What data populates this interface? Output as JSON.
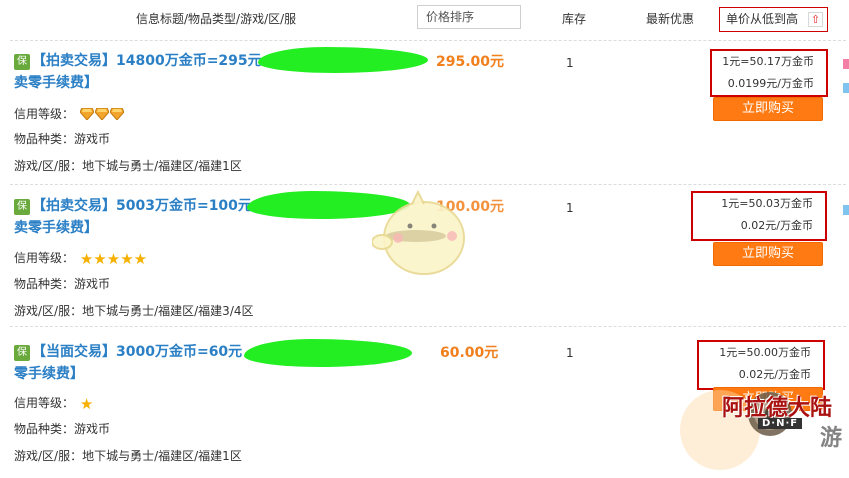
{
  "header": {
    "title_col": "信息标题/物品类型/游戏/区/服",
    "sort_price": "价格排序",
    "stock": "库存",
    "promo": "最新优惠",
    "unit_sort": "单价从低到高",
    "unit_sort_arrow": "up-arrow-icon"
  },
  "listings": [
    {
      "badge": "保",
      "title_line1": "【拍卖交易】14800万金币=295元",
      "title_line2": "卖零手续费】",
      "price": "295.00元",
      "stock": "1",
      "credit_label": "信用等级：",
      "credit_icons": "gem x3",
      "item_type_label": "物品种类：",
      "item_type": "游戏币",
      "server_label": "游戏/区/服：",
      "server": "地下城与勇士/福建区/福建1区",
      "unit_price_1": "1元=50.17万金币",
      "unit_price_2": "0.0199元/万金币",
      "buy_label": "立即购买"
    },
    {
      "badge": "保",
      "title_line1": "【拍卖交易】5003万金币=100元",
      "title_line2": "卖零手续费】",
      "price": "100.00元",
      "stock": "1",
      "credit_label": "信用等级：",
      "credit_icons": "star x5",
      "item_type_label": "物品种类：",
      "item_type": "游戏币",
      "server_label": "游戏/区/服：",
      "server": "地下城与勇士/福建区/福建3/4区",
      "unit_price_1": "1元=50.03万金币",
      "unit_price_2": "0.02元/万金币",
      "buy_label": "立即购买"
    },
    {
      "badge": "保",
      "title_line1": "【当面交易】3000万金币=60元",
      "title_line2": "零手续费】",
      "price": "60.00元",
      "stock": "1",
      "credit_label": "信用等级：",
      "credit_icons": "star x1",
      "item_type_label": "物品种类：",
      "item_type": "游戏币",
      "server_label": "游戏/区/服：",
      "server": "地下城与勇士/福建区/福建1区",
      "unit_price_1": "1元=50.00万金币",
      "unit_price_2": "0.02元/万金币",
      "buy_label": "立即购买"
    }
  ],
  "watermark": {
    "logo_text": "阿拉德大陆",
    "logo_sub": "D·N·F",
    "site_suffix": "游"
  },
  "colors": {
    "title_blue": "#2a7fc5",
    "price_orange": "#f07f1c",
    "buy_orange": "#ff7a12",
    "highlight_red": "#cc0000",
    "badge_green": "#6aaa3c",
    "redaction_green": "#22ee22"
  }
}
